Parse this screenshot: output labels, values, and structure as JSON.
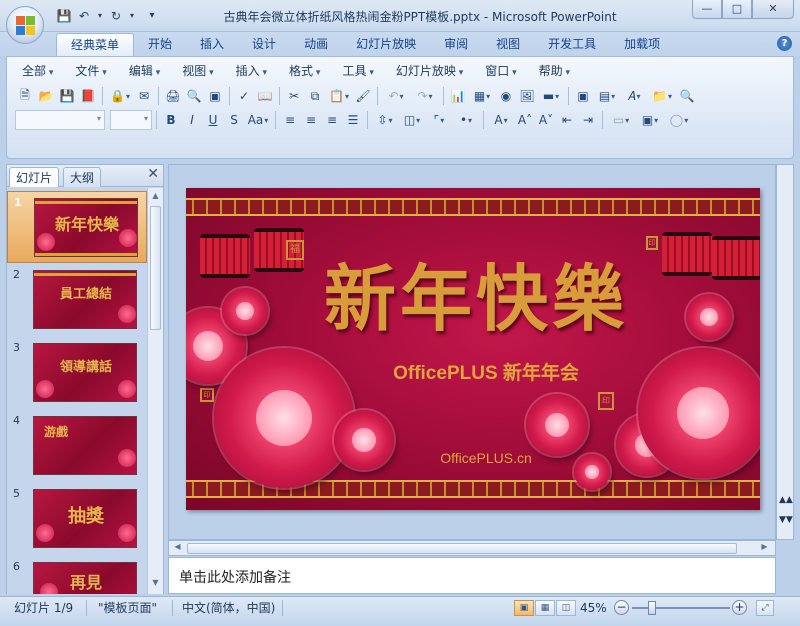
{
  "window": {
    "title": "古典年会微立体折纸风格热闹金粉PPT模板.pptx - Microsoft PowerPoint",
    "controls": {
      "minimize": "—",
      "maximize": "□",
      "close": "✕"
    }
  },
  "qat": {
    "save": "save-icon",
    "undo": "undo-icon",
    "redo": "redo-icon",
    "customize": "▾"
  },
  "ribbon_tabs": [
    "经典菜单",
    "开始",
    "插入",
    "设计",
    "动画",
    "幻灯片放映",
    "审阅",
    "视图",
    "开发工具",
    "加载项"
  ],
  "active_tab": "经典菜单",
  "help": "?",
  "menus": [
    "全部",
    "文件",
    "编辑",
    "视图",
    "插入",
    "格式",
    "工具",
    "幻灯片放映",
    "窗口",
    "帮助"
  ],
  "pane": {
    "tab_slides": "幻灯片",
    "tab_outline": "大纲",
    "close": "✕",
    "thumbnails": [
      {
        "num": "1",
        "title": "新年快樂",
        "selected": true
      },
      {
        "num": "2",
        "title": "員工總結",
        "selected": false
      },
      {
        "num": "3",
        "title": "領導講話",
        "selected": false
      },
      {
        "num": "4",
        "title": "游戲",
        "selected": false
      },
      {
        "num": "5",
        "title": "抽獎",
        "selected": false
      },
      {
        "num": "6",
        "title": "再見",
        "selected": false
      }
    ]
  },
  "slide": {
    "title": "新年快樂",
    "subtitle": "OfficePLUS 新年年会",
    "url": "OfficePLUS.cn",
    "seal_left": "福",
    "seal_small": "印",
    "colors": {
      "background": "#a30d3a",
      "gold": "#d99c3a"
    }
  },
  "notes": {
    "placeholder": "单击此处添加备注"
  },
  "statusbar": {
    "slide_indicator": "幻灯片 1/9",
    "theme": "\"模板页面\"",
    "language": "中文(简体，中国)",
    "zoom": "45%",
    "zoom_out": "−",
    "zoom_in": "+"
  }
}
